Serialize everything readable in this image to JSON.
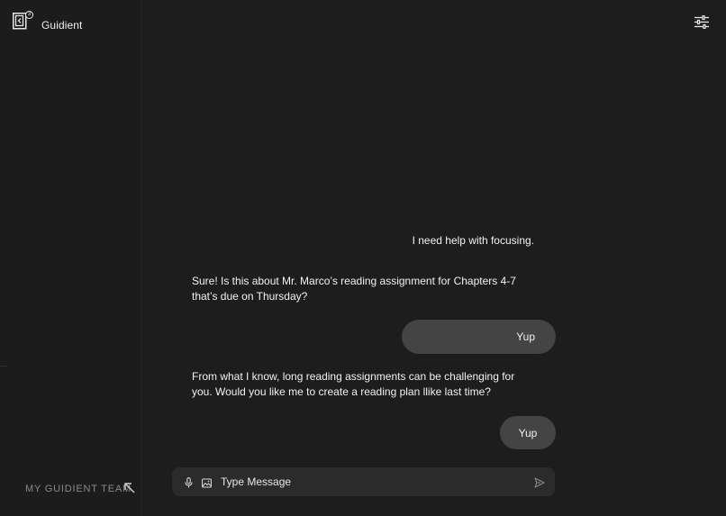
{
  "app": {
    "title": "Guidient",
    "logo_badge": "3",
    "logo_icon": "book-logo-icon"
  },
  "header": {
    "settings_icon": "sliders-icon"
  },
  "sidebar": {
    "team_label": "MY GUIDIENT TEAM",
    "team_icon": "arrow-up-left-icon"
  },
  "chat": {
    "messages": [
      {
        "role": "user",
        "text": "I need help with focusing."
      },
      {
        "role": "assistant",
        "text": "Sure! Is this about Mr. Marco’s reading assignment for Chapters 4-7 that’s due on Thursday?"
      },
      {
        "role": "user",
        "text": "Yup"
      },
      {
        "role": "assistant",
        "text": "From what I know, long reading assignments can be challenging for you. Would you like me to create a reading plan llike last time?"
      },
      {
        "role": "user",
        "text": "Yup"
      }
    ]
  },
  "composer": {
    "placeholder": "Type Message",
    "value": "",
    "mic_icon": "microphone-icon",
    "image_icon": "image-icon",
    "send_icon": "send-icon"
  },
  "colors": {
    "background": "#1d1d1e",
    "bubble": "#444445",
    "composer": "#2b2b2c",
    "muted_text": "#8a8a8c",
    "text": "#f2f2f2"
  }
}
